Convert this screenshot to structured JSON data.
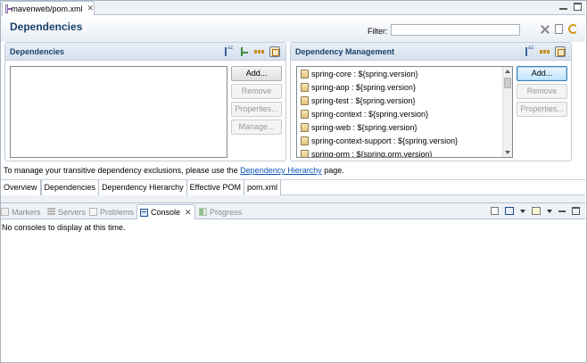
{
  "editor": {
    "tab_title": "mavenweb/pom.xml",
    "tab_close": "✕"
  },
  "header": {
    "title": "Dependencies",
    "filter_label": "Filter:",
    "filter_value": ""
  },
  "dependencies": {
    "title": "Dependencies",
    "items": [],
    "buttons": {
      "add": "Add...",
      "remove": "Remove",
      "properties": "Properties...",
      "manage": "Manage..."
    }
  },
  "dependency_management": {
    "title": "Dependency Management",
    "items": [
      "spring-core : ${spring.version}",
      "spring-aop : ${spring.version}",
      "spring-test : ${spring.version}",
      "spring-context : ${spring.version}",
      "spring-web : ${spring.version}",
      "spring-context-support : ${spring.version}",
      "spring-orm : ${spring.orm.version}"
    ],
    "buttons": {
      "add": "Add...",
      "remove": "Remove",
      "properties": "Properties..."
    }
  },
  "hint": {
    "before": "To manage your transitive dependency exclusions, please use the ",
    "link": "Dependency Hierarchy",
    "after": " page."
  },
  "page_tabs": [
    "Overview",
    "Dependencies",
    "Dependency Hierarchy",
    "Effective POM",
    "pom.xml"
  ],
  "active_page_tab": "Dependencies",
  "views": {
    "tabs": [
      "Markers",
      "Servers",
      "Problems",
      "Console",
      "Progress"
    ],
    "active": "Console",
    "close": "✕"
  },
  "console": {
    "message": "No consoles to display at this time."
  },
  "colors": {
    "title": "#19426c",
    "link": "#0b53b9",
    "section_header": "#d6e1ee"
  }
}
